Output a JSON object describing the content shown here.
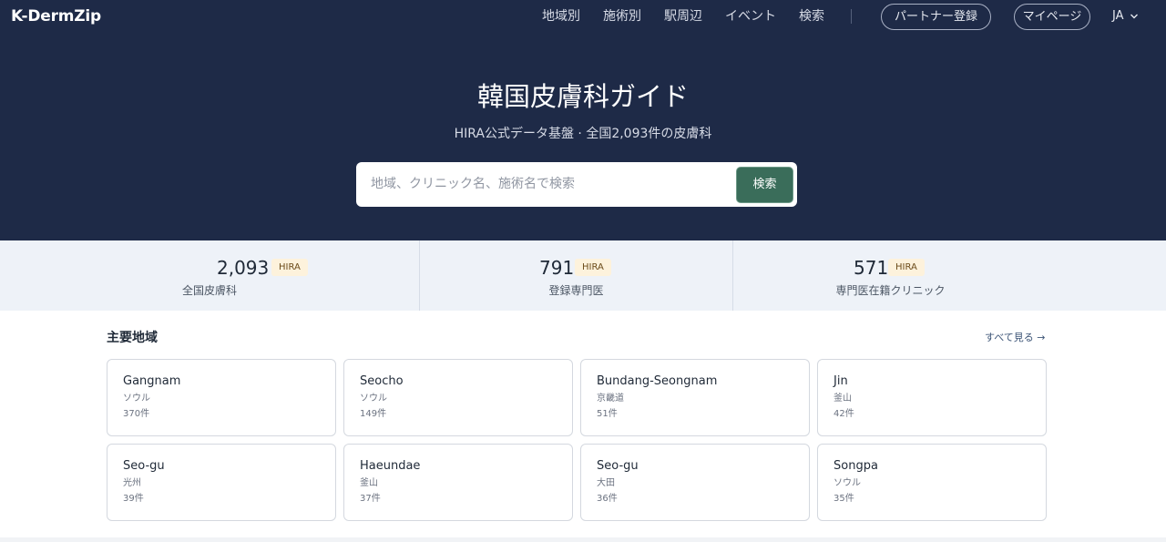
{
  "header": {
    "logo": "K-DermZip",
    "nav": [
      "地域別",
      "施術別",
      "駅周辺",
      "イベント",
      "検索"
    ],
    "partner_label": "パートナー登録",
    "mypage_label": "マイページ",
    "language": "JA",
    "language_icon": "chevron-down-icon"
  },
  "hero": {
    "title": "韓国皮膚科ガイド",
    "subtitle": "HIRA公式データ基盤 · 全国2,093件の皮膚科",
    "search_placeholder": "地域、クリニック名、施術名で検索",
    "search_value": "",
    "search_button": "検索"
  },
  "stats": [
    {
      "value": "2,093",
      "badge": "HIRA",
      "label": "全国皮膚科"
    },
    {
      "value": "791",
      "badge": "HIRA",
      "label": "登録専門医"
    },
    {
      "value": "571",
      "badge": "HIRA",
      "label": "専門医在籍クリニック"
    }
  ],
  "regions": {
    "title": "主要地域",
    "see_all": "すべて見る →",
    "cards": [
      {
        "name": "Gangnam",
        "city": "ソウル",
        "count": "370件"
      },
      {
        "name": "Seocho",
        "city": "ソウル",
        "count": "149件"
      },
      {
        "name": "Bundang-Seongnam",
        "city": "京畿道",
        "count": "51件"
      },
      {
        "name": "Jin",
        "city": "釜山",
        "count": "42件"
      },
      {
        "name": "Seo-gu",
        "city": "光州",
        "count": "39件"
      },
      {
        "name": "Haeundae",
        "city": "釜山",
        "count": "37件"
      },
      {
        "name": "Seo-gu",
        "city": "大田",
        "count": "36件"
      },
      {
        "name": "Songpa",
        "city": "ソウル",
        "count": "35件"
      }
    ]
  },
  "colors": {
    "hero_bg": "#1e2a47",
    "accent": "#3a6d5a",
    "stats_bg": "#eef2f8",
    "badge_bg": "#fdf2dc"
  }
}
